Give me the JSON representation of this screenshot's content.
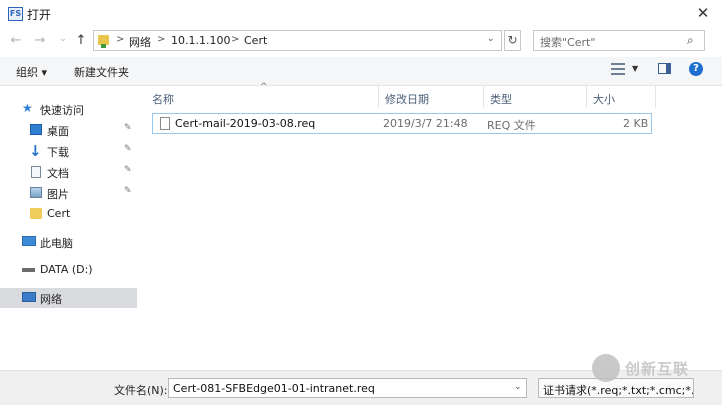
{
  "window": {
    "title": "打开",
    "app_icon_text": "FS",
    "close_glyph": "✕"
  },
  "nav_buttons": {
    "back": "←",
    "forward": "→",
    "recent": "⌄",
    "up": "↑"
  },
  "address": {
    "crumbs": [
      "网络",
      "10.1.1.100",
      "Cert"
    ],
    "separator": ">",
    "dropdown": "⌄",
    "refresh": "↻"
  },
  "search": {
    "placeholder": "搜索\"Cert\"",
    "icon": "search-icon"
  },
  "toolbar": {
    "organize": "组织 ▾",
    "new_folder": "新建文件夹",
    "help": "?"
  },
  "nav": {
    "items": [
      {
        "label": "快速访问",
        "icon": "star-icon"
      },
      {
        "label": "桌面",
        "icon": "desktop-icon",
        "pinned": true
      },
      {
        "label": "下载",
        "icon": "download-icon",
        "pinned": true
      },
      {
        "label": "文档",
        "icon": "document-icon",
        "pinned": true
      },
      {
        "label": "图片",
        "icon": "picture-icon",
        "pinned": true
      },
      {
        "label": "Cert",
        "icon": "folder-icon"
      },
      {
        "label": "此电脑",
        "icon": "computer-icon"
      },
      {
        "label": "DATA (D:)",
        "icon": "drive-icon"
      },
      {
        "label": "网络",
        "icon": "network-icon",
        "selected": true
      }
    ],
    "pin_glyph": "📌"
  },
  "columns": [
    "名称",
    "修改日期",
    "类型",
    "大小"
  ],
  "sort_arrow": "^",
  "files": [
    {
      "name": "Cert-mail-2019-03-08.req",
      "modified": "2019/3/7 21:48",
      "type": "REQ 文件",
      "size": "2 KB"
    }
  ],
  "footer": {
    "filename_label": "文件名(N):",
    "filename_value": "Cert-081-SFBEdge01-01-intranet.req",
    "filetype_value": "证书请求(*.req;*.txt;*.cmc;*.de"
  },
  "watermark": {
    "text": "创新互联"
  },
  "colors": {
    "selected_bg": "#d9dbde",
    "row_border": "#99c8ee",
    "accent": "#1e6fd0"
  }
}
